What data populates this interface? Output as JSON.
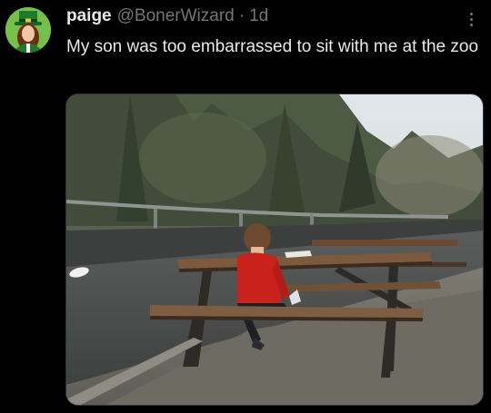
{
  "post": {
    "display_name": "paige",
    "handle": "@BonerWizard",
    "separator": "·",
    "timestamp": "1d",
    "text": "My son was too embarrassed to sit with me at the zoo"
  },
  "icons": {
    "more": "more-options-icon",
    "avatar": "profile-avatar"
  },
  "colors": {
    "background": "#000000",
    "primary_text": "#e7e9ea",
    "secondary_text": "#71767b",
    "border": "#2f3336"
  }
}
